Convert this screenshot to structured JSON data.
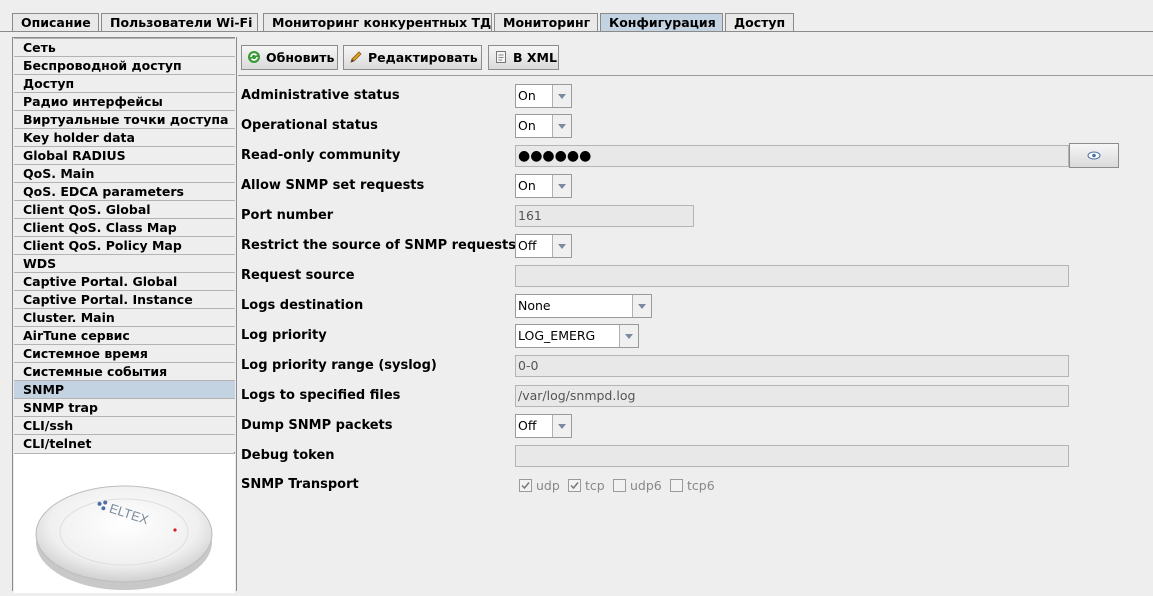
{
  "tabs": [
    {
      "label": "Описание"
    },
    {
      "label": "Пользователи Wi-Fi"
    },
    {
      "label": "Мониторинг конкурентных ТД"
    },
    {
      "label": "Мониторинг"
    },
    {
      "label": "Конфигурация",
      "active": true
    },
    {
      "label": "Доступ"
    }
  ],
  "sidebar": {
    "items": [
      {
        "label": "Сеть"
      },
      {
        "label": "Беспроводной доступ"
      },
      {
        "label": "Доступ"
      },
      {
        "label": "Радио интерфейсы"
      },
      {
        "label": "Виртуальные точки доступа"
      },
      {
        "label": "Key holder data"
      },
      {
        "label": "Global RADIUS"
      },
      {
        "label": "QoS. Main"
      },
      {
        "label": "QoS. EDCA parameters"
      },
      {
        "label": "Client QoS. Global"
      },
      {
        "label": "Client QoS. Class Map"
      },
      {
        "label": "Client QoS. Policy Map"
      },
      {
        "label": "WDS"
      },
      {
        "label": "Captive Portal. Global"
      },
      {
        "label": "Captive Portal. Instance"
      },
      {
        "label": "Cluster. Main"
      },
      {
        "label": "AirTune сервис"
      },
      {
        "label": "Системное время"
      },
      {
        "label": "Системные события"
      },
      {
        "label": "SNMP",
        "selected": true
      },
      {
        "label": "SNMP trap"
      },
      {
        "label": "CLI/ssh"
      },
      {
        "label": "CLI/telnet"
      }
    ],
    "device_brand": "ELTEX"
  },
  "toolbar": {
    "refresh_label": "Обновить",
    "edit_label": "Редактировать",
    "xml_label": "В XML"
  },
  "form": {
    "admin_status": {
      "label": "Administrative status",
      "value": "On"
    },
    "oper_status": {
      "label": "Operational status",
      "value": "On"
    },
    "ro_community": {
      "label": "Read-only community",
      "value": "●●●●●●"
    },
    "allow_set": {
      "label": "Allow SNMP set requests",
      "value": "On"
    },
    "port": {
      "label": "Port number",
      "value": "161"
    },
    "restrict_source": {
      "label": "Restrict the source of SNMP requests",
      "value": "Off"
    },
    "request_source": {
      "label": "Request source",
      "value": ""
    },
    "logs_destination": {
      "label": "Logs destination",
      "value": "None"
    },
    "log_priority": {
      "label": "Log priority",
      "value": "LOG_EMERG"
    },
    "log_priority_range": {
      "label": "Log priority range (syslog)",
      "value": "0-0"
    },
    "logs_files": {
      "label": "Logs to specified files",
      "value": "/var/log/snmpd.log"
    },
    "dump_packets": {
      "label": "Dump SNMP packets",
      "value": "Off"
    },
    "debug_token": {
      "label": "Debug token",
      "value": ""
    },
    "transport": {
      "label": "SNMP Transport",
      "options": [
        {
          "label": "udp",
          "checked": true
        },
        {
          "label": "tcp",
          "checked": true
        },
        {
          "label": "udp6",
          "checked": false
        },
        {
          "label": "tcp6",
          "checked": false
        }
      ]
    }
  },
  "colors": {
    "active_tab": "#c4d3e2",
    "selected_item": "#c4d3e2",
    "background": "#eeeeee"
  }
}
